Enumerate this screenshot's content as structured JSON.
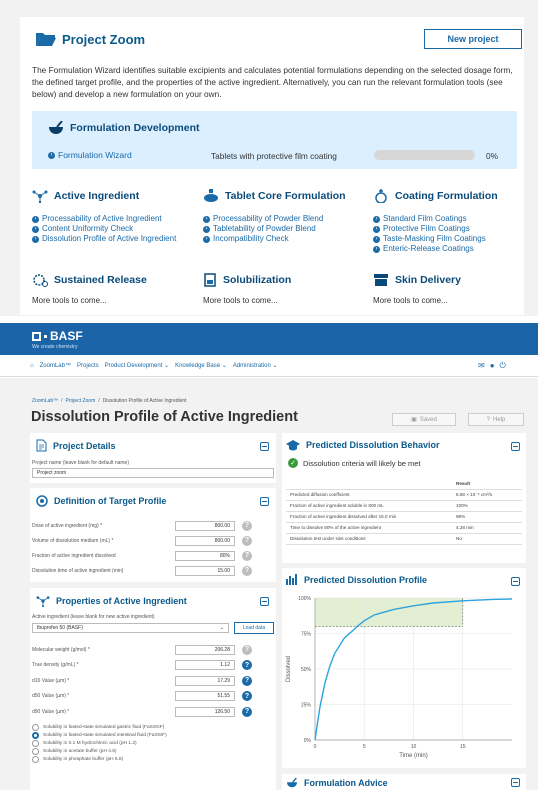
{
  "project_zoom": {
    "title": "Project Zoom",
    "new_project": "New project",
    "intro": "The Formulation Wizard identifies suitable excipients and calculates potential formulations depending on the selected dosage form, the defined target profile, and the properties of the active ingredient. Alternatively, you can run the relevant formulation tools (see below) and develop a new formulation on your own.",
    "formulation_development": {
      "title": "Formulation Development",
      "wizard_link": "Formulation Wizard",
      "description": "Tablets with protective film coating",
      "progress_label": "0%",
      "progress": 0
    },
    "tools": [
      {
        "title": "Active Ingredient",
        "links": [
          "Processability of Active Ingredient",
          "Content Uniformity Check",
          "Dissolution Profile of Active Ingredient"
        ]
      },
      {
        "title": "Tablet Core Formulation",
        "links": [
          "Processability of Powder Blend",
          "Tabletability of Powder Blend",
          "Incompatibility Check"
        ]
      },
      {
        "title": "Coating Formulation",
        "links": [
          "Standard Film Coatings",
          "Protective Film Coatings",
          "Taste-Masking Film Coatings",
          "Enteric-Release Coatings"
        ]
      },
      {
        "title": "Sustained Release",
        "more": "More tools to come..."
      },
      {
        "title": "Solubilization",
        "more": "More tools to come..."
      },
      {
        "title": "Skin Delivery",
        "more": "More tools to come..."
      }
    ]
  },
  "app": {
    "brand": "BASF",
    "tagline": "We create chemistry",
    "nav": [
      "ZoomLab™",
      "Projects",
      "Product Development",
      "Knowledge Base",
      "Administration"
    ],
    "breadcrumb": [
      "ZoomLab™",
      "Project Zoom",
      "Dissolution Profile of Active Ingredient"
    ],
    "page_title": "Dissolution Profile of Active Ingredient",
    "saved": "Saved",
    "help": "Help"
  },
  "project_details": {
    "title": "Project Details",
    "name_label": "Project name (leave blank for default name)",
    "name_value": "Project zoom"
  },
  "target_profile": {
    "title": "Definition of Target Profile",
    "fields": [
      {
        "label": "Dose of active ingredient (mg) *",
        "value": "800.00"
      },
      {
        "label": "Volume of dissolution medium (mL) *",
        "value": "800.00"
      },
      {
        "label": "Fraction of active ingredient dissolved",
        "value": "80%"
      },
      {
        "label": "Dissolution time of active ingredient (min)",
        "value": "15.00"
      }
    ]
  },
  "properties": {
    "title": "Properties of Active Ingredient",
    "select_label": "Active ingredient (leave blank for new active ingredient)",
    "select_value": "Ibuprofen 50 (BASF)",
    "load_button": "Load data",
    "fields": [
      {
        "label": "Molecular weight (g/mol) *",
        "value": "206.28"
      },
      {
        "label": "True density (g/mL) *",
        "value": "1.12"
      },
      {
        "label": "d10 Value (µm) *",
        "value": "17.29"
      },
      {
        "label": "d50 Value (µm) *",
        "value": "51.55"
      },
      {
        "label": "d90 Value (µm) *",
        "value": "126.50"
      }
    ],
    "radios": [
      {
        "label": "Solubility in fasted-state simulated gastric fluid (FaSSGF)",
        "selected": false
      },
      {
        "label": "Solubility in fasted-state simulated intestinal fluid (FaSSIF)",
        "selected": true
      },
      {
        "label": "Solubility in 0.1 M hydrochloric acid (pH 1.2)",
        "selected": false
      },
      {
        "label": "Solubility in acetate buffer (pH 4.5)",
        "selected": false
      },
      {
        "label": "Solubility in phosphate buffer (pH 6.8)",
        "selected": false
      }
    ]
  },
  "predicted_behavior": {
    "title": "Predicted Dissolution Behavior",
    "status": "Dissolution criteria will likely be met",
    "result_header": "Result",
    "rows": [
      {
        "label": "Predicted diffusion coefficient",
        "value": "8.88 × 10⁻⁶ cm²/s"
      },
      {
        "label": "Fraction of active ingredient soluble in 800 mL",
        "value": "100%"
      },
      {
        "label": "Fraction of active ingredient dissolved after 15.0 min",
        "value": "98%"
      },
      {
        "label": "Time to dissolve 80% of the active ingredient",
        "value": "4.28 min"
      },
      {
        "label": "Dissolution test under sink conditions",
        "value": "No"
      }
    ]
  },
  "predicted_profile": {
    "title": "Predicted Dissolution Profile"
  },
  "formulation_advice": {
    "title": "Formulation Advice"
  },
  "chart_data": {
    "type": "line",
    "xlabel": "Time (min)",
    "ylabel": "Dissolved",
    "xlim": [
      0,
      20
    ],
    "ylim": [
      0,
      100
    ],
    "x_ticks": [
      "0",
      "5",
      "10",
      "15"
    ],
    "y_ticks": [
      "0%",
      "25%",
      "50%",
      "75%",
      "100%"
    ],
    "target_fraction": 80,
    "target_time": 15,
    "x": [
      0,
      0.25,
      0.5,
      1,
      1.5,
      2,
      3,
      4,
      4.28,
      5,
      6,
      8,
      10,
      12,
      15,
      18,
      20
    ],
    "y": [
      0,
      12,
      23,
      40,
      52,
      61,
      72,
      78,
      80,
      84,
      88,
      92,
      94.5,
      96.5,
      98,
      99,
      99.3
    ]
  }
}
